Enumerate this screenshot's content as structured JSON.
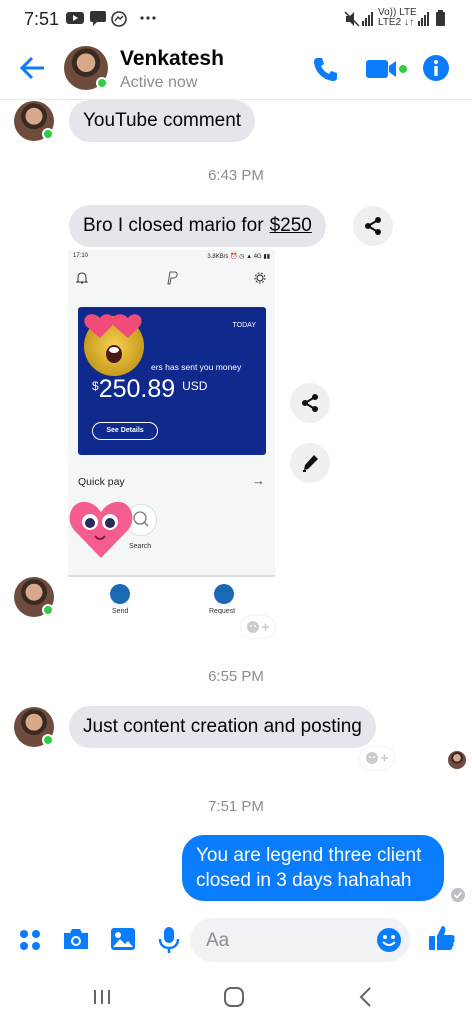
{
  "status_bar": {
    "time": "7:51",
    "right_text_top": "Vo)) LTE",
    "right_text_bottom": "LTE2 ↓↑"
  },
  "header": {
    "contact_name": "Venkatesh",
    "presence": "Active now"
  },
  "messages": [
    {
      "text": "YouTube comment"
    },
    {
      "timestamp": "6:43 PM"
    },
    {
      "text": "Bro I closed mario for",
      "amount": "$250"
    },
    {
      "timestamp": "6:55 PM"
    },
    {
      "text": "Just content creation and posting"
    },
    {
      "timestamp": "7:51 PM"
    },
    {
      "lines": [
        "You are legend three client",
        "closed in 3 days hahahah"
      ]
    }
  ],
  "shared_image": {
    "status_time": "17:10",
    "status_right": "3.8KB/s ⏰ ◷ ▲ 4G ▮▮",
    "card_label": "TODAY",
    "sent_text": "ers has sent you money",
    "currency_symbol": "$",
    "amount": "250.89",
    "currency": "USD",
    "details_button": "See Details",
    "quick_pay": "Quick pay",
    "search_label": "Search",
    "send_label": "Send",
    "request_label": "Request"
  },
  "composer": {
    "placeholder": "Aa"
  },
  "colors": {
    "accent": "#0a7cff",
    "bubble_in": "#e4e6eb",
    "online": "#31cc46",
    "card_blue": "#0f2a8c"
  }
}
